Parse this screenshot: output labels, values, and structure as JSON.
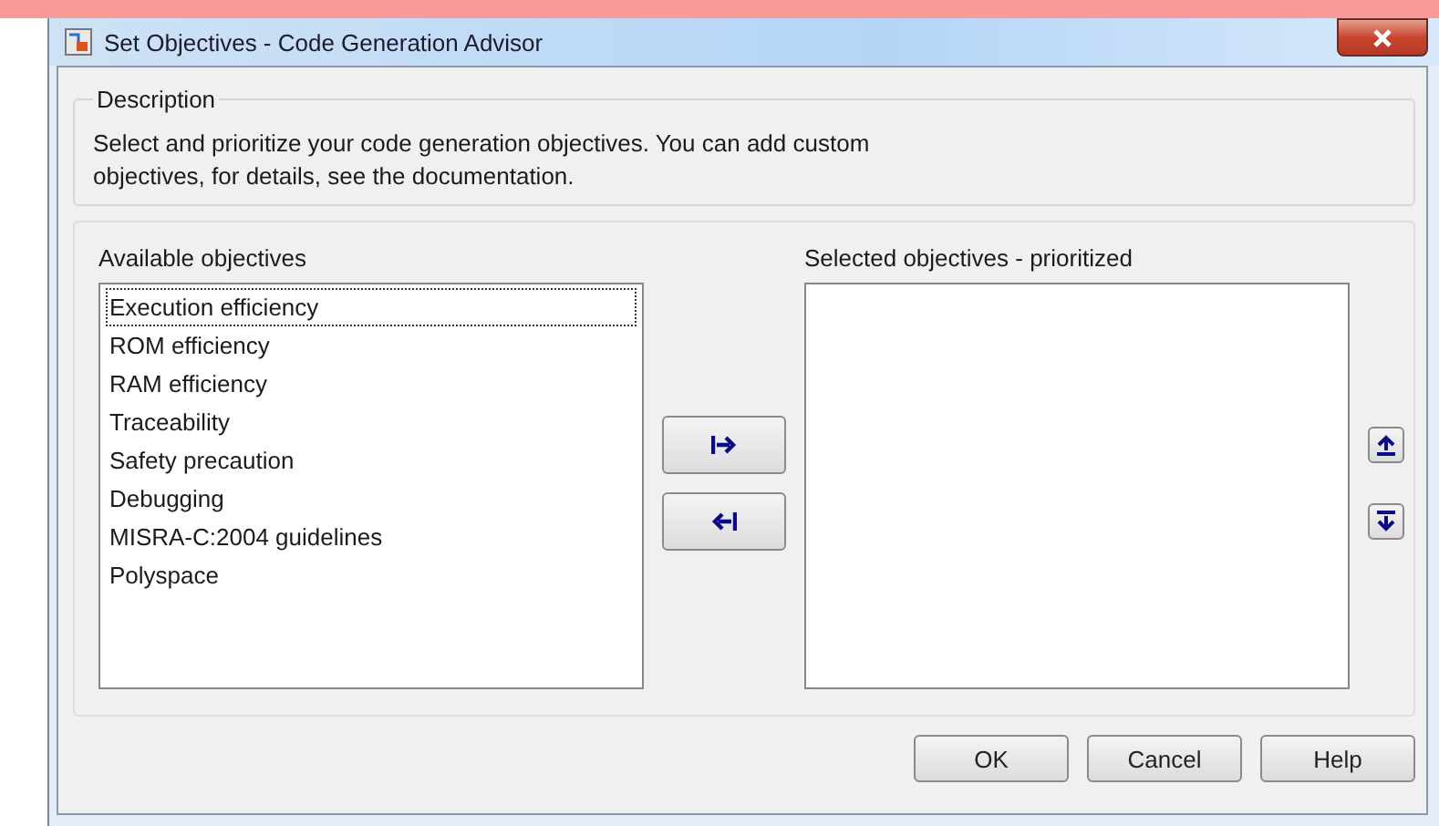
{
  "window": {
    "title": "Set Objectives - Code Generation Advisor"
  },
  "description": {
    "legend": "Description",
    "text": "Select and prioritize your code generation objectives. You can add custom objectives, for details, see the documentation."
  },
  "available": {
    "label": "Available objectives",
    "items": [
      {
        "label": "Execution efficiency",
        "focused": true
      },
      {
        "label": "ROM efficiency",
        "focused": false
      },
      {
        "label": "RAM efficiency",
        "focused": false
      },
      {
        "label": "Traceability",
        "focused": false
      },
      {
        "label": "Safety precaution",
        "focused": false
      },
      {
        "label": "Debugging",
        "focused": false
      },
      {
        "label": "MISRA-C:2004 guidelines",
        "focused": false
      },
      {
        "label": "Polyspace",
        "focused": false
      }
    ]
  },
  "selected_list": {
    "label": "Selected objectives - prioritized"
  },
  "buttons": [
    "OK",
    "Cancel",
    "Help"
  ]
}
